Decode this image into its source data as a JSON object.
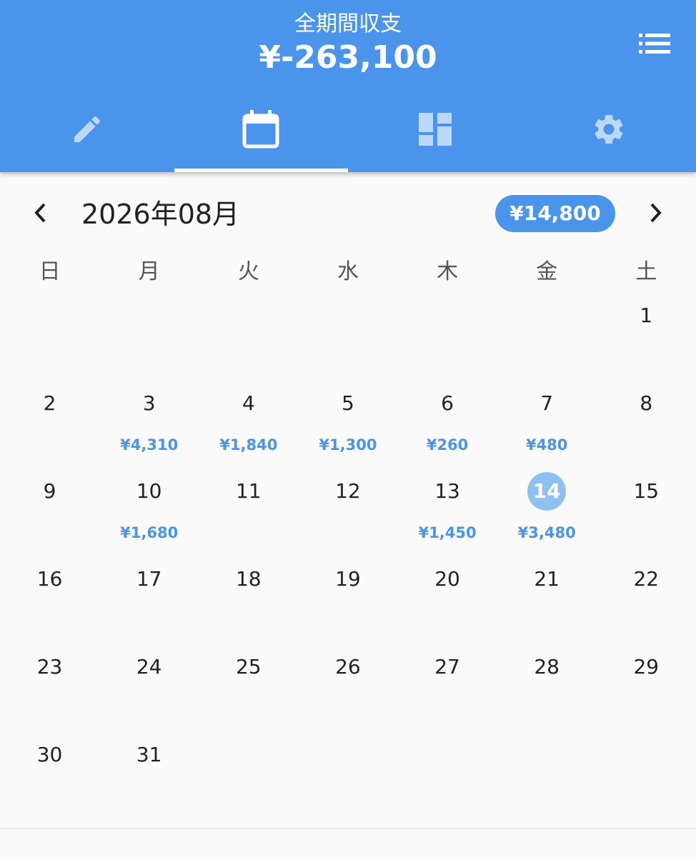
{
  "header": {
    "title": "全期間収支",
    "total": "¥-263,100",
    "list_icon": "list-icon"
  },
  "tabs": [
    {
      "name": "input",
      "icon": "pencil-icon",
      "active": false
    },
    {
      "name": "calendar",
      "icon": "calendar-icon",
      "active": true
    },
    {
      "name": "report",
      "icon": "dashboard-icon",
      "active": false
    },
    {
      "name": "settings",
      "icon": "gear-icon",
      "active": false
    }
  ],
  "month_bar": {
    "label": "2026年08月",
    "total": "¥14,800"
  },
  "weekdays": [
    "日",
    "月",
    "火",
    "水",
    "木",
    "金",
    "土"
  ],
  "calendar": {
    "weeks": [
      [
        {
          "day": "",
          "amount": ""
        },
        {
          "day": "",
          "amount": ""
        },
        {
          "day": "",
          "amount": ""
        },
        {
          "day": "",
          "amount": ""
        },
        {
          "day": "",
          "amount": ""
        },
        {
          "day": "",
          "amount": ""
        },
        {
          "day": "1",
          "amount": ""
        }
      ],
      [
        {
          "day": "2",
          "amount": ""
        },
        {
          "day": "3",
          "amount": "¥4,310"
        },
        {
          "day": "4",
          "amount": "¥1,840"
        },
        {
          "day": "5",
          "amount": "¥1,300"
        },
        {
          "day": "6",
          "amount": "¥260"
        },
        {
          "day": "7",
          "amount": "¥480"
        },
        {
          "day": "8",
          "amount": ""
        }
      ],
      [
        {
          "day": "9",
          "amount": ""
        },
        {
          "day": "10",
          "amount": "¥1,680"
        },
        {
          "day": "11",
          "amount": ""
        },
        {
          "day": "12",
          "amount": ""
        },
        {
          "day": "13",
          "amount": "¥1,450"
        },
        {
          "day": "14",
          "amount": "¥3,480",
          "selected": true
        },
        {
          "day": "15",
          "amount": ""
        }
      ],
      [
        {
          "day": "16",
          "amount": ""
        },
        {
          "day": "17",
          "amount": ""
        },
        {
          "day": "18",
          "amount": ""
        },
        {
          "day": "19",
          "amount": ""
        },
        {
          "day": "20",
          "amount": ""
        },
        {
          "day": "21",
          "amount": ""
        },
        {
          "day": "22",
          "amount": ""
        }
      ],
      [
        {
          "day": "23",
          "amount": ""
        },
        {
          "day": "24",
          "amount": ""
        },
        {
          "day": "25",
          "amount": ""
        },
        {
          "day": "26",
          "amount": ""
        },
        {
          "day": "27",
          "amount": ""
        },
        {
          "day": "28",
          "amount": ""
        },
        {
          "day": "29",
          "amount": ""
        }
      ],
      [
        {
          "day": "30",
          "amount": ""
        },
        {
          "day": "31",
          "amount": ""
        },
        {
          "day": "",
          "amount": ""
        },
        {
          "day": "",
          "amount": ""
        },
        {
          "day": "",
          "amount": ""
        },
        {
          "day": "",
          "amount": ""
        },
        {
          "day": "",
          "amount": ""
        }
      ]
    ]
  },
  "colors": {
    "primary": "#4b94ec",
    "selected_day": "#8fc0f2",
    "amount_text": "#4b94ec"
  }
}
